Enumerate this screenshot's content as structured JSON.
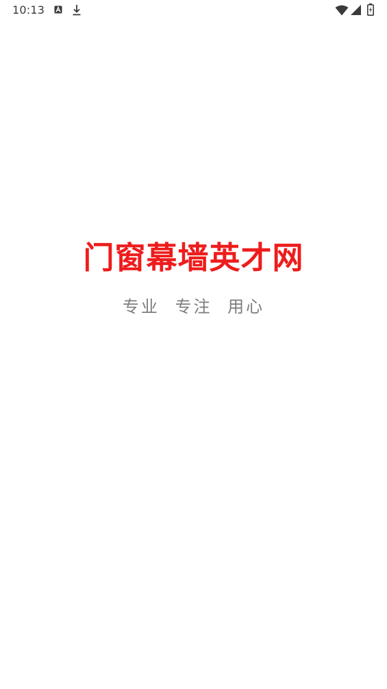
{
  "status_bar": {
    "time": "10:13",
    "icons": [
      "autofill-a-icon",
      "download-icon",
      "wifi-icon",
      "cell-signal-icon",
      "battery-charging-icon"
    ]
  },
  "splash": {
    "title": "门窗幕墙英才网",
    "slogan_parts": [
      "专业",
      "专注",
      "用心"
    ]
  },
  "colors": {
    "title": "#ee1c1c",
    "slogan": "#7d7d7d",
    "background": "#ffffff"
  }
}
